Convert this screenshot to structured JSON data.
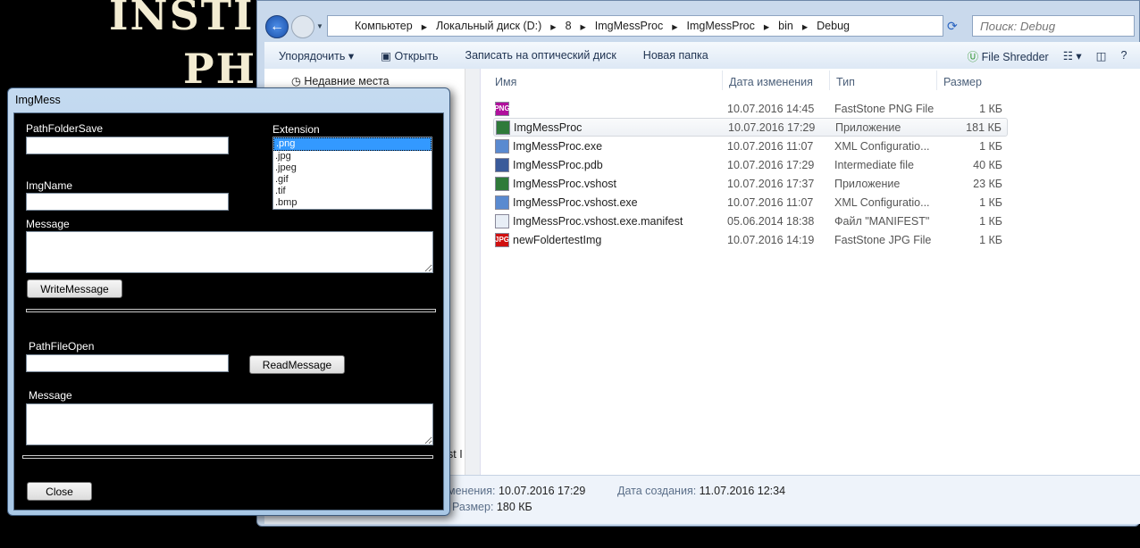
{
  "background": {
    "text_line1": "INSTI",
    "text_line2": "PH"
  },
  "explorer": {
    "breadcrumb": [
      "Компьютер",
      "Локальный диск (D:)",
      "8",
      "ImgMessProc",
      "ImgMessProc",
      "bin",
      "Debug"
    ],
    "search_placeholder": "Поиск: Debug",
    "toolbar": {
      "organize": "Упорядочить",
      "open": "Открыть",
      "burn": "Записать на оптический диск",
      "new_folder": "Новая папка",
      "shredder": "File Shredder"
    },
    "nav": {
      "recent": "Недавние места",
      "partial": "st I"
    },
    "columns": {
      "name": "Имя",
      "date": "Дата изменения",
      "type": "Тип",
      "size": "Размер"
    },
    "files": [
      {
        "name": "",
        "date": "10.07.2016 14:45",
        "type": "FastStone PNG File",
        "size": "1 КБ",
        "icon": "png-file-icon",
        "badge": "PNG"
      },
      {
        "name": "ImgMessProc",
        "date": "10.07.2016 17:29",
        "type": "Приложение",
        "size": "181 КБ",
        "icon": "application-icon",
        "badge": ""
      },
      {
        "name": "ImgMessProc.exe",
        "date": "10.07.2016 11:07",
        "type": "XML Configuratio...",
        "size": "1 КБ",
        "icon": "xml-config-icon",
        "badge": ""
      },
      {
        "name": "ImgMessProc.pdb",
        "date": "10.07.2016 17:29",
        "type": "Intermediate file",
        "size": "40 КБ",
        "icon": "pdb-file-icon",
        "badge": ""
      },
      {
        "name": "ImgMessProc.vshost",
        "date": "10.07.2016 17:37",
        "type": "Приложение",
        "size": "23 КБ",
        "icon": "application-icon",
        "badge": ""
      },
      {
        "name": "ImgMessProc.vshost.exe",
        "date": "10.07.2016 11:07",
        "type": "XML Configuratio...",
        "size": "1 КБ",
        "icon": "xml-config-icon",
        "badge": ""
      },
      {
        "name": "ImgMessProc.vshost.exe.manifest",
        "date": "05.06.2014 18:38",
        "type": "Файл \"MANIFEST\"",
        "size": "1 КБ",
        "icon": "file-icon",
        "badge": ""
      },
      {
        "name": "newFoldertestImg",
        "date": "10.07.2016 14:19",
        "type": "FastStone JPG File",
        "size": "1 КБ",
        "icon": "jpg-file-icon",
        "badge": "JPG"
      }
    ],
    "details": {
      "modified_label": "менения:",
      "modified": "10.07.2016 17:29",
      "created_label": "Дата создания:",
      "created": "11.07.2016 12:34",
      "size_label": "Размер:",
      "size": "180 КБ"
    }
  },
  "dialog": {
    "title": "ImgMess",
    "path_folder_save_label": "PathFolderSave",
    "path_folder_save_value": "",
    "extension_label": "Extension",
    "extensions": [
      ".png",
      ".jpg",
      ".jpeg",
      ".gif",
      ".tif",
      ".bmp"
    ],
    "img_name_label": "ImgName",
    "img_name_value": "",
    "message_label": "Message",
    "message_value": "",
    "write_button": "WriteMessage",
    "path_file_open_label": "PathFileOpen",
    "path_file_open_value": "",
    "read_button": "ReadMessage",
    "message2_label": "Message",
    "message2_value": "",
    "close_button": "Close"
  }
}
